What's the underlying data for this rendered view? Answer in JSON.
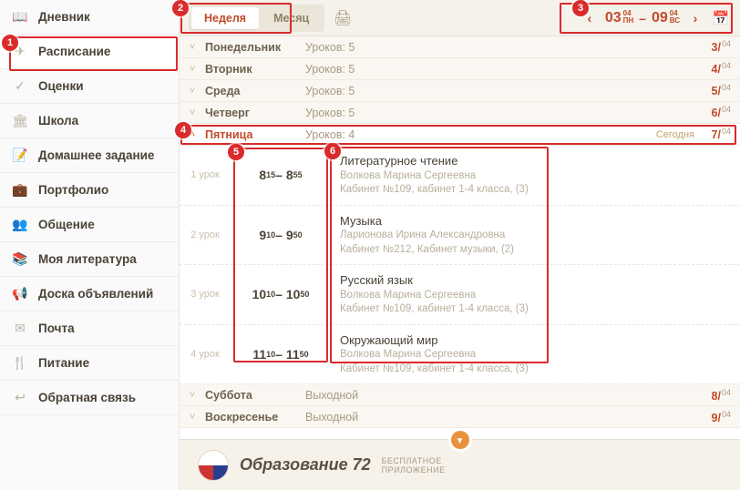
{
  "sidebar": [
    {
      "icon": "📖",
      "label": "Дневник"
    },
    {
      "icon": "✈",
      "label": "Расписание",
      "active": true
    },
    {
      "icon": "✓",
      "label": "Оценки"
    },
    {
      "icon": "🏛",
      "label": "Школа"
    },
    {
      "icon": "📝",
      "label": "Домашнее задание"
    },
    {
      "icon": "💼",
      "label": "Портфолио"
    },
    {
      "icon": "👥",
      "label": "Общение"
    },
    {
      "icon": "📚",
      "label": "Моя литература"
    },
    {
      "icon": "📢",
      "label": "Доска объявлений"
    },
    {
      "icon": "✉",
      "label": "Почта"
    },
    {
      "icon": "🍴",
      "label": "Питание"
    },
    {
      "icon": "↩",
      "label": "Обратная связь"
    }
  ],
  "toolbar": {
    "tab_week": "Неделя",
    "tab_month": "Месяц",
    "range_from_day": "03",
    "range_from_sup1": "04",
    "range_from_sup2": "ПН",
    "range_dash": "–",
    "range_to_day": "09",
    "range_to_sup1": "04",
    "range_to_sup2": "ВС"
  },
  "days": [
    {
      "name": "Понедельник",
      "info": "Уроков: 5",
      "date": "3",
      "month": "04"
    },
    {
      "name": "Вторник",
      "info": "Уроков: 5",
      "date": "4",
      "month": "04"
    },
    {
      "name": "Среда",
      "info": "Уроков: 5",
      "date": "5",
      "month": "04"
    },
    {
      "name": "Четверг",
      "info": "Уроков: 5",
      "date": "6",
      "month": "04"
    },
    {
      "name": "Пятница",
      "info": "Уроков: 4",
      "date": "7",
      "month": "04",
      "today": "Сегодня",
      "open": true
    },
    {
      "name": "Суббота",
      "info": "Выходной",
      "date": "8",
      "month": "04"
    },
    {
      "name": "Воскресенье",
      "info": "Выходной",
      "date": "9",
      "month": "04"
    }
  ],
  "lessons": [
    {
      "num": "1 урок",
      "t1": "8",
      "s1": "15",
      "t2": "8",
      "s2": "55",
      "title": "Литературное чтение",
      "teacher": "Волкова Марина Сергеевна",
      "room": "Кабинет №109, кабинет 1-4 класса, (3)"
    },
    {
      "num": "2 урок",
      "t1": "9",
      "s1": "10",
      "t2": "9",
      "s2": "50",
      "title": "Музыка",
      "teacher": "Ларионова Ирина Александровна",
      "room": "Кабинет №212, Кабинет музыки, (2)"
    },
    {
      "num": "3 урок",
      "t1": "10",
      "s1": "10",
      "t2": "10",
      "s2": "50",
      "title": "Русский язык",
      "teacher": "Волкова Марина Сергеевна",
      "room": "Кабинет №109, кабинет 1-4 класса, (3)"
    },
    {
      "num": "4 урок",
      "t1": "11",
      "s1": "10",
      "t2": "11",
      "s2": "50",
      "title": "Окружающий мир",
      "teacher": "Волкова Марина Сергеевна",
      "room": "Кабинет №109, кабинет 1-4 класса, (3)"
    }
  ],
  "banner": {
    "title": "Образование 72",
    "line1": "БЕСПЛАТНОЕ",
    "line2": "ПРИЛОЖЕНИЕ"
  },
  "annotations": {
    "m1": "1",
    "m2": "2",
    "m3": "3",
    "m4": "4",
    "m5": "5",
    "m6": "6"
  }
}
